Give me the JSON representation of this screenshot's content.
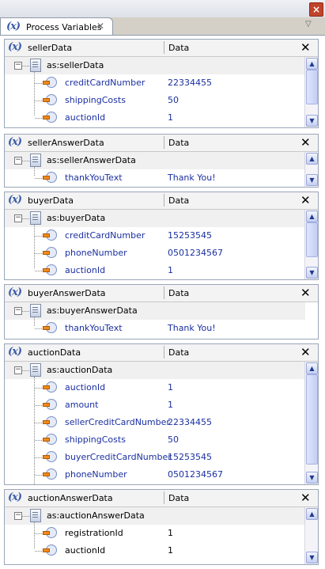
{
  "window": {
    "close_glyph": "×"
  },
  "tab": {
    "icon": "(x)",
    "label": "Process Variables",
    "close_glyph": "✕",
    "menu_glyph": "▽"
  },
  "panels": [
    {
      "title": "sellerData",
      "column": "Data",
      "close_glyph": "✕",
      "root": "as:sellerData",
      "rows": [
        {
          "name": "creditCardNumber",
          "value": "22334455"
        },
        {
          "name": "shippingCosts",
          "value": "50"
        },
        {
          "name": "auctionId",
          "value": "1"
        }
      ]
    },
    {
      "title": "sellerAnswerData",
      "column": "Data",
      "close_glyph": "✕",
      "root": "as:sellerAnswerData",
      "rows": [
        {
          "name": "thankYouText",
          "value": "Thank You!"
        }
      ]
    },
    {
      "title": "buyerData",
      "column": "Data",
      "close_glyph": "✕",
      "root": "as:buyerData",
      "rows": [
        {
          "name": "creditCardNumber",
          "value": "15253545"
        },
        {
          "name": "phoneNumber",
          "value": "0501234567"
        },
        {
          "name": "auctionId",
          "value": "1"
        }
      ]
    },
    {
      "title": "buyerAnswerData",
      "column": "Data",
      "close_glyph": "✕",
      "root": "as:buyerAnswerData",
      "rows": [
        {
          "name": "thankYouText",
          "value": "Thank You!"
        }
      ]
    },
    {
      "title": "auctionData",
      "column": "Data",
      "close_glyph": "✕",
      "root": "as:auctionData",
      "rows": [
        {
          "name": "auctionId",
          "value": "1"
        },
        {
          "name": "amount",
          "value": "1"
        },
        {
          "name": "sellerCreditCardNumber",
          "value": "22334455"
        },
        {
          "name": "shippingCosts",
          "value": "50"
        },
        {
          "name": "buyerCreditCardNumber",
          "value": "15253545"
        },
        {
          "name": "phoneNumber",
          "value": "0501234567"
        }
      ]
    },
    {
      "title": "auctionAnswerData",
      "column": "Data",
      "close_glyph": "✕",
      "root": "as:auctionAnswerData",
      "rows": [
        {
          "name": "registrationId",
          "value": "1"
        },
        {
          "name": "auctionId",
          "value": "1"
        }
      ]
    }
  ]
}
